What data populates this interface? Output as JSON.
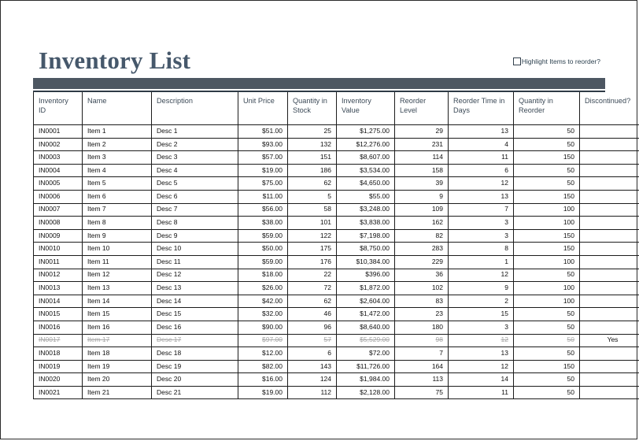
{
  "page": {
    "title": "Inventory List"
  },
  "options": {
    "highlight_label": "Highlight Items to reorder?",
    "highlight_checked": false
  },
  "theme": {
    "accent_bar": "#4d5762",
    "title_color": "#46586b",
    "header_text": "#3c4a57",
    "struck_text": "#a8a8a8"
  },
  "table": {
    "columns": [
      {
        "key": "id",
        "label": "Inventory ID",
        "align": "left"
      },
      {
        "key": "name",
        "label": "Name",
        "align": "left"
      },
      {
        "key": "desc",
        "label": "Description",
        "align": "left"
      },
      {
        "key": "price",
        "label": "Unit Price",
        "align": "right"
      },
      {
        "key": "qty",
        "label": "Quantity in Stock",
        "align": "right"
      },
      {
        "key": "val",
        "label": "Inventory Value",
        "align": "right"
      },
      {
        "key": "reo",
        "label": "Reorder Level",
        "align": "right"
      },
      {
        "key": "time",
        "label": "Reorder Time in Days",
        "align": "right"
      },
      {
        "key": "qir",
        "label": "Quantity in Reorder",
        "align": "right"
      },
      {
        "key": "disc",
        "label": "Discontinued?",
        "align": "center"
      }
    ],
    "rows": [
      {
        "id": "IN0001",
        "name": "Item 1",
        "desc": "Desc 1",
        "price": "$51.00",
        "qty": "25",
        "val": "$1,275.00",
        "reo": "29",
        "time": "13",
        "qir": "50",
        "disc": "",
        "struck": false
      },
      {
        "id": "IN0002",
        "name": "Item 2",
        "desc": "Desc 2",
        "price": "$93.00",
        "qty": "132",
        "val": "$12,276.00",
        "reo": "231",
        "time": "4",
        "qir": "50",
        "disc": "",
        "struck": false
      },
      {
        "id": "IN0003",
        "name": "Item 3",
        "desc": "Desc 3",
        "price": "$57.00",
        "qty": "151",
        "val": "$8,607.00",
        "reo": "114",
        "time": "11",
        "qir": "150",
        "disc": "",
        "struck": false
      },
      {
        "id": "IN0004",
        "name": "Item 4",
        "desc": "Desc 4",
        "price": "$19.00",
        "qty": "186",
        "val": "$3,534.00",
        "reo": "158",
        "time": "6",
        "qir": "50",
        "disc": "",
        "struck": false
      },
      {
        "id": "IN0005",
        "name": "Item 5",
        "desc": "Desc 5",
        "price": "$75.00",
        "qty": "62",
        "val": "$4,650.00",
        "reo": "39",
        "time": "12",
        "qir": "50",
        "disc": "",
        "struck": false
      },
      {
        "id": "IN0006",
        "name": "Item 6",
        "desc": "Desc 6",
        "price": "$11.00",
        "qty": "5",
        "val": "$55.00",
        "reo": "9",
        "time": "13",
        "qir": "150",
        "disc": "",
        "struck": false
      },
      {
        "id": "IN0007",
        "name": "Item 7",
        "desc": "Desc 7",
        "price": "$56.00",
        "qty": "58",
        "val": "$3,248.00",
        "reo": "109",
        "time": "7",
        "qir": "100",
        "disc": "",
        "struck": false
      },
      {
        "id": "IN0008",
        "name": "Item 8",
        "desc": "Desc 8",
        "price": "$38.00",
        "qty": "101",
        "val": "$3,838.00",
        "reo": "162",
        "time": "3",
        "qir": "100",
        "disc": "",
        "struck": false
      },
      {
        "id": "IN0009",
        "name": "Item 9",
        "desc": "Desc 9",
        "price": "$59.00",
        "qty": "122",
        "val": "$7,198.00",
        "reo": "82",
        "time": "3",
        "qir": "150",
        "disc": "",
        "struck": false
      },
      {
        "id": "IN0010",
        "name": "Item 10",
        "desc": "Desc 10",
        "price": "$50.00",
        "qty": "175",
        "val": "$8,750.00",
        "reo": "283",
        "time": "8",
        "qir": "150",
        "disc": "",
        "struck": false
      },
      {
        "id": "IN0011",
        "name": "Item 11",
        "desc": "Desc 11",
        "price": "$59.00",
        "qty": "176",
        "val": "$10,384.00",
        "reo": "229",
        "time": "1",
        "qir": "100",
        "disc": "",
        "struck": false
      },
      {
        "id": "IN0012",
        "name": "Item 12",
        "desc": "Desc 12",
        "price": "$18.00",
        "qty": "22",
        "val": "$396.00",
        "reo": "36",
        "time": "12",
        "qir": "50",
        "disc": "",
        "struck": false
      },
      {
        "id": "IN0013",
        "name": "Item 13",
        "desc": "Desc 13",
        "price": "$26.00",
        "qty": "72",
        "val": "$1,872.00",
        "reo": "102",
        "time": "9",
        "qir": "100",
        "disc": "",
        "struck": false
      },
      {
        "id": "IN0014",
        "name": "Item 14",
        "desc": "Desc 14",
        "price": "$42.00",
        "qty": "62",
        "val": "$2,604.00",
        "reo": "83",
        "time": "2",
        "qir": "100",
        "disc": "",
        "struck": false
      },
      {
        "id": "IN0015",
        "name": "Item 15",
        "desc": "Desc 15",
        "price": "$32.00",
        "qty": "46",
        "val": "$1,472.00",
        "reo": "23",
        "time": "15",
        "qir": "50",
        "disc": "",
        "struck": false
      },
      {
        "id": "IN0016",
        "name": "Item 16",
        "desc": "Desc 16",
        "price": "$90.00",
        "qty": "96",
        "val": "$8,640.00",
        "reo": "180",
        "time": "3",
        "qir": "50",
        "disc": "",
        "struck": false
      },
      {
        "id": "IN0017",
        "name": "Item 17",
        "desc": "Desc 17",
        "price": "$97.00",
        "qty": "57",
        "val": "$5,529.00",
        "reo": "98",
        "time": "12",
        "qir": "50",
        "disc": "Yes",
        "struck": true
      },
      {
        "id": "IN0018",
        "name": "Item 18",
        "desc": "Desc 18",
        "price": "$12.00",
        "qty": "6",
        "val": "$72.00",
        "reo": "7",
        "time": "13",
        "qir": "50",
        "disc": "",
        "struck": false
      },
      {
        "id": "IN0019",
        "name": "Item 19",
        "desc": "Desc 19",
        "price": "$82.00",
        "qty": "143",
        "val": "$11,726.00",
        "reo": "164",
        "time": "12",
        "qir": "150",
        "disc": "",
        "struck": false
      },
      {
        "id": "IN0020",
        "name": "Item 20",
        "desc": "Desc 20",
        "price": "$16.00",
        "qty": "124",
        "val": "$1,984.00",
        "reo": "113",
        "time": "14",
        "qir": "50",
        "disc": "",
        "struck": false
      },
      {
        "id": "IN0021",
        "name": "Item 21",
        "desc": "Desc 21",
        "price": "$19.00",
        "qty": "112",
        "val": "$2,128.00",
        "reo": "75",
        "time": "11",
        "qir": "50",
        "disc": "",
        "struck": false
      }
    ]
  }
}
